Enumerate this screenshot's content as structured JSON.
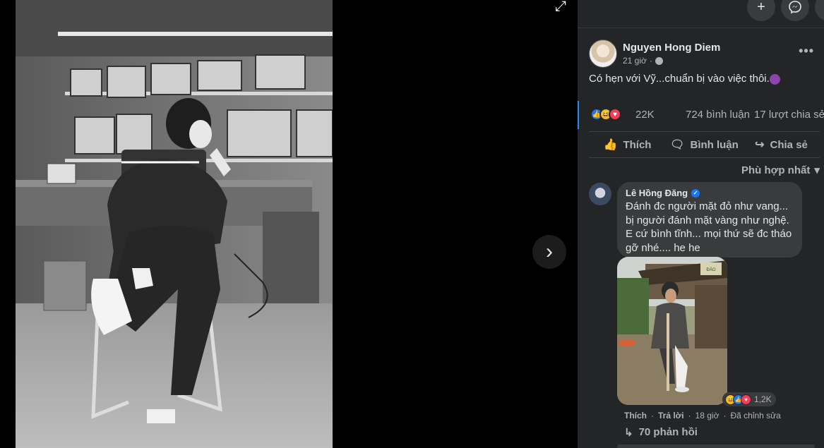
{
  "post": {
    "author": "Nguyen Hong Diem",
    "time": "21 giờ",
    "text": "Có hẹn với Vỹ...chuẩn bị vào việc thôi.",
    "reaction_count": "22K",
    "comments_count": "724 bình luận",
    "shares_count": "17 lượt chia sẻ"
  },
  "actions": {
    "like": "Thích",
    "comment": "Bình luận",
    "share": "Chia sẻ"
  },
  "sort_label": "Phù hợp nhất",
  "comment": {
    "author": "Lê Hồng Đăng",
    "text": "Đánh đc người mặt đỏ như vang... bị người đánh mặt vàng như nghệ. E cứ bình tĩnh... mọi thứ sẽ đc tháo gỡ nhé.... he he",
    "reaction_count": "1,2K",
    "like_label": "Thích",
    "reply_label": "Trả lời",
    "time": "18 giờ",
    "edited_label": "Đã chỉnh sửa",
    "replies_label": "70 phản hồi",
    "photo_sign_text": "ĐẢO"
  },
  "icons": {
    "expand": "expand-icon",
    "next": "chevron-right-icon",
    "add": "plus-icon",
    "messenger": "messenger-icon",
    "privacy": "globe-icon",
    "more": "more-icon"
  },
  "colors": {
    "panel_bg": "#242526",
    "bubble_bg": "#3a3b3c",
    "accent": "#1877f2",
    "text_primary": "#e4e6eb",
    "text_secondary": "#b0b3b8"
  }
}
